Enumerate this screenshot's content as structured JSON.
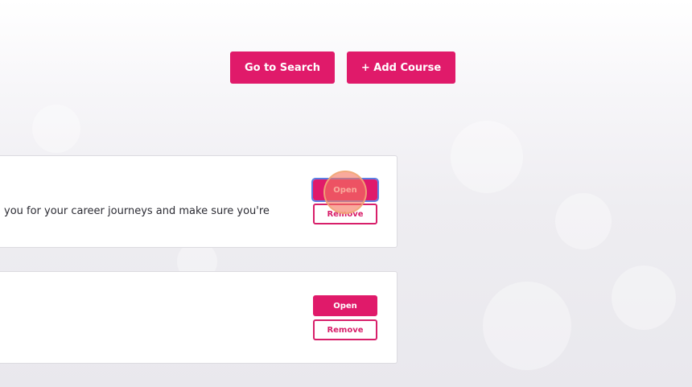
{
  "top_actions": {
    "go_to_search_label": "Go to Search",
    "add_course_label": "+ Add Course"
  },
  "courses": [
    {
      "description": "you for your career journeys and make sure you're",
      "open_label": "Open",
      "remove_label": "Remove"
    },
    {
      "description": "",
      "open_label": "Open",
      "remove_label": "Remove"
    }
  ],
  "colors": {
    "accent": "#e01a6a",
    "remove_border": "#d81f6a",
    "focus_outline": "#5b7fe3",
    "click_marker": "#f67660"
  }
}
